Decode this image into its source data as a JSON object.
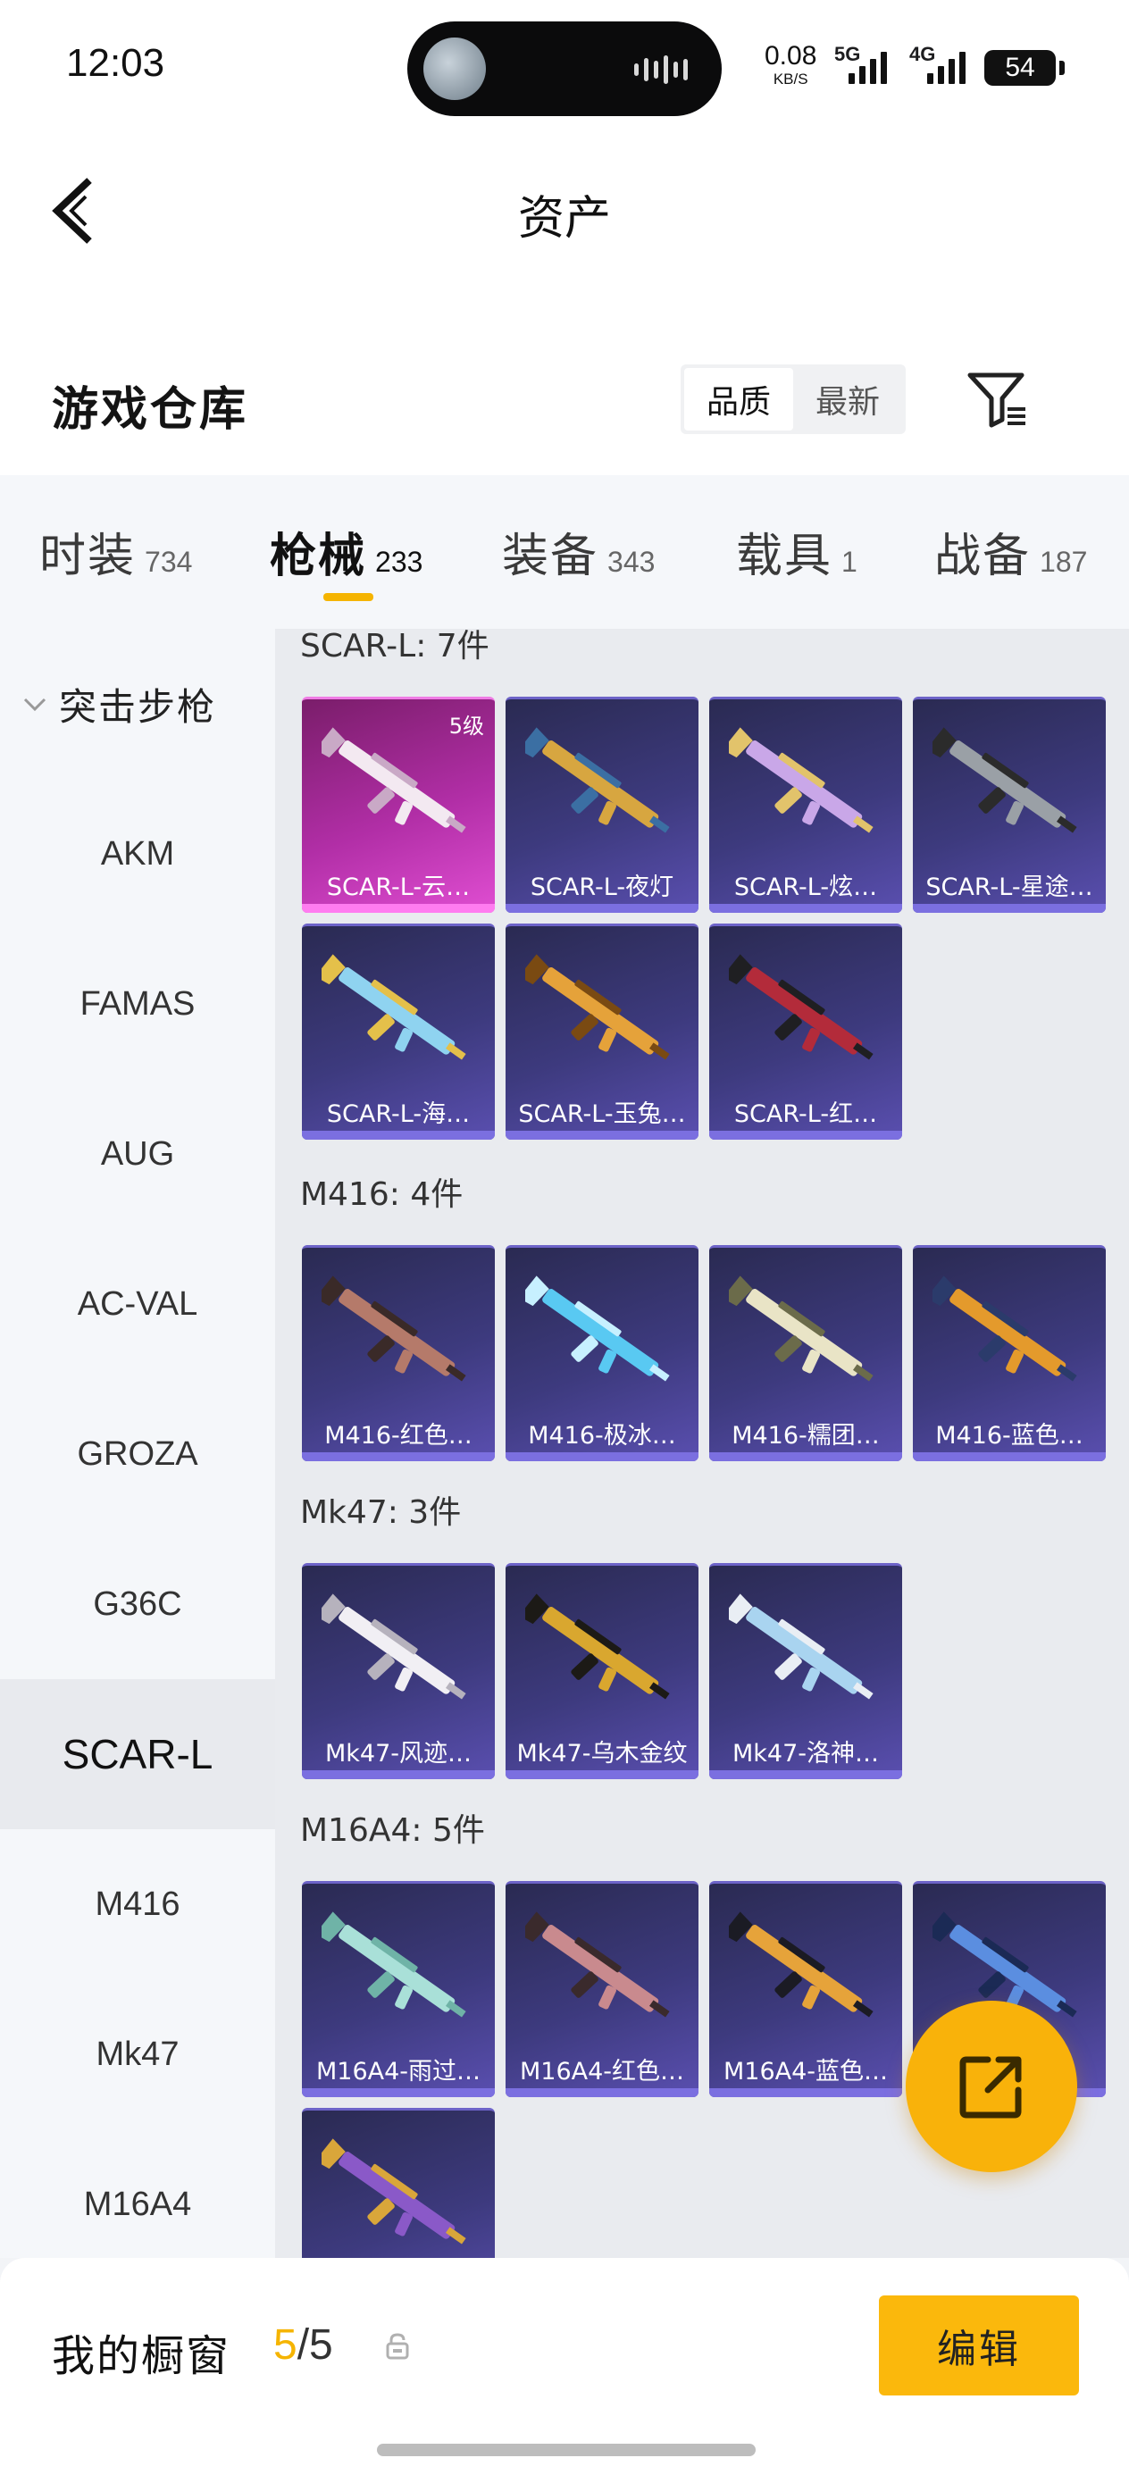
{
  "status_bar": {
    "time": "12:03",
    "net_speed": "0.08",
    "net_unit": "KB/S",
    "sig1_label": "5G",
    "sig2_label": "4G",
    "battery": "54"
  },
  "header": {
    "title": "资产",
    "back_icon": "chevron-left-icon"
  },
  "warehouse": {
    "title": "游戏仓库",
    "sort_options": [
      {
        "label": "品质",
        "active": true
      },
      {
        "label": "最新",
        "active": false
      }
    ],
    "filter_icon": "filter-icon"
  },
  "tabs": [
    {
      "name": "时装",
      "count": "734"
    },
    {
      "name": "枪械",
      "count": "233",
      "active": true
    },
    {
      "name": "装备",
      "count": "343"
    },
    {
      "name": "载具",
      "count": "1"
    },
    {
      "name": "战备",
      "count": "187"
    }
  ],
  "sidebar": {
    "group": "突击步枪",
    "items": [
      "AKM",
      "FAMAS",
      "AUG",
      "AC-VAL",
      "GROZA",
      "G36C",
      "SCAR-L",
      "M416",
      "Mk47",
      "M16A4"
    ],
    "active": "SCAR-L"
  },
  "sections": [
    {
      "title": "SCAR-L: 7件",
      "items": [
        {
          "name": "SCAR-L-云…",
          "level": "5级",
          "rarity": "pink",
          "colors": [
            "#f3e9f1",
            "#c9a9c6"
          ]
        },
        {
          "name": "SCAR-L-夜灯",
          "colors": [
            "#d7a640",
            "#3b6fa3"
          ]
        },
        {
          "name": "SCAR-L-炫…",
          "colors": [
            "#c9a7e8",
            "#e2c36b"
          ]
        },
        {
          "name": "SCAR-L-星途…",
          "colors": [
            "#9aa0a6",
            "#2b2b2b"
          ]
        },
        {
          "name": "SCAR-L-海…",
          "colors": [
            "#8fd3f0",
            "#e4c04a"
          ]
        },
        {
          "name": "SCAR-L-玉兔…",
          "colors": [
            "#e5a23a",
            "#7a4a12"
          ]
        },
        {
          "name": "SCAR-L-红…",
          "colors": [
            "#b32b3a",
            "#1f1f22"
          ]
        }
      ]
    },
    {
      "title": "M416: 4件",
      "items": [
        {
          "name": "M416-红色…",
          "colors": [
            "#b57a6a",
            "#3a2a28"
          ]
        },
        {
          "name": "M416-极冰…",
          "colors": [
            "#59c9f2",
            "#c7f0ff"
          ]
        },
        {
          "name": "M416-糯团…",
          "colors": [
            "#e9e4c6",
            "#6b6b4a"
          ]
        },
        {
          "name": "M416-蓝色…",
          "colors": [
            "#e49a2c",
            "#2b3b6b"
          ]
        }
      ]
    },
    {
      "title": "Mk47: 3件",
      "items": [
        {
          "name": "Mk47-风迹…",
          "colors": [
            "#f1eff4",
            "#b6b2bd"
          ]
        },
        {
          "name": "Mk47-乌木金纹",
          "colors": [
            "#d9a72f",
            "#1c1a16"
          ]
        },
        {
          "name": "Mk47-洛神…",
          "colors": [
            "#a9d4f0",
            "#e9eef4"
          ]
        }
      ]
    },
    {
      "title": "M16A4: 5件",
      "items": [
        {
          "name": "M16A4-雨过…",
          "colors": [
            "#a9e0d8",
            "#6fb3a7"
          ]
        },
        {
          "name": "M16A4-红色…",
          "colors": [
            "#c98a8e",
            "#3a2a2c"
          ]
        },
        {
          "name": "M16A4-蓝色…",
          "colors": [
            "#e6a33a",
            "#1b1b24"
          ]
        },
        {
          "name": "",
          "colors": [
            "#5b8ee0",
            "#1b2a55"
          ]
        },
        {
          "name": "",
          "colors": [
            "#8a59c8",
            "#d9a63a"
          ]
        }
      ]
    }
  ],
  "fab": {
    "icon": "share-external-icon"
  },
  "bottom": {
    "showcase_label": "我的橱窗",
    "showcase_current": "5",
    "showcase_total": "/5",
    "lock_icon": "lock-icon",
    "edit_label": "编辑"
  },
  "colors": {
    "accent": "#f5b400",
    "fab": "#f9b20a",
    "card_bg": "#3d3a7e",
    "card_pink": "#b12ea6"
  }
}
